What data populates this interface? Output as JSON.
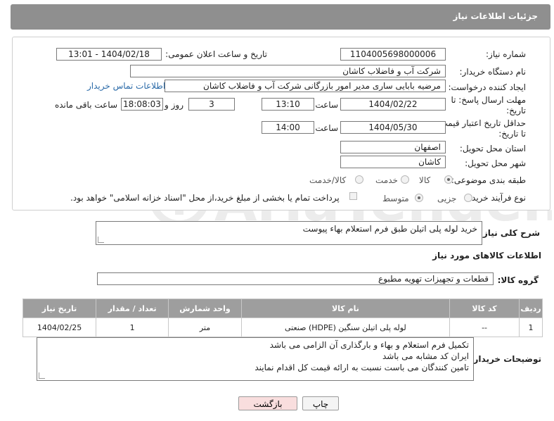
{
  "header": {
    "title": "جزئیات اطلاعات نیاز"
  },
  "need_number": {
    "label": "شماره نیاز:",
    "value": "1104005698000006"
  },
  "announce": {
    "label": "تاریخ و ساعت اعلان عمومی:",
    "value": "1404/02/18 - 13:01"
  },
  "buyer_org": {
    "label": "نام دستگاه خریدار:",
    "value": "شرکت آب و فاضلاب کاشان"
  },
  "creator": {
    "label": "ایجاد کننده درخواست:",
    "value": "مرضیه بابایی ساری مدیر امور بازرگانی شرکت آب و فاضلاب کاشان",
    "contact_link": "اطلاعات تماس خریدار"
  },
  "reply_deadline": {
    "label": "مهلت ارسال پاسخ: تا تاریخ:",
    "date": "1404/02/22",
    "time_label": "ساعت",
    "time": "13:10",
    "days": "3",
    "days_label": "روز و",
    "remaining": "18:08:03",
    "remaining_label": "ساعت باقی مانده"
  },
  "price_validity": {
    "label": "حداقل تاریخ اعتبار قیمت: تا تاریخ:",
    "date": "1404/05/30",
    "time_label": "ساعت",
    "time": "14:00"
  },
  "province": {
    "label": "استان محل تحویل:",
    "value": "اصفهان"
  },
  "city": {
    "label": "شهر محل تحویل:",
    "value": "کاشان"
  },
  "category": {
    "label": "طبقه بندی موضوعی:",
    "options": [
      "کالا",
      "خدمت",
      "کالا/خدمت"
    ],
    "selected": "کالا"
  },
  "purchase_type": {
    "label": "نوع فرآیند خرید :",
    "options": [
      "جزیی",
      "متوسط"
    ],
    "selected": "متوسط",
    "treasury_note": "پرداخت تمام یا بخشی از مبلغ خرید،از محل \"اسناد خزانه اسلامی\" خواهد بود."
  },
  "description": {
    "label": "شرح کلی نیاز:",
    "value": "خرید لوله پلی اتیلن طبق فرم استعلام بهاء پیوست"
  },
  "goods_section": {
    "title": "اطلاعات کالاهای مورد نیاز"
  },
  "goods_group": {
    "label": "گروه کالا:",
    "value": "قطعات و تجهیزات تهویه مطبوع"
  },
  "table": {
    "headers": [
      "ردیف",
      "کد کالا",
      "نام کالا",
      "واحد شمارش",
      "تعداد / مقدار",
      "تاریخ نیاز"
    ],
    "rows": [
      [
        "1",
        "--",
        "لوله پلی اتیلن سنگین (HDPE) صنعتی",
        "متر",
        "1",
        "1404/02/25"
      ]
    ]
  },
  "buyer_notes": {
    "label": "توضیحات خریدار:",
    "lines": [
      "تکمیل فرم استعلام و بهاء و بارگذاری آن الزامی می باشد",
      "ایران کد مشابه می باشد",
      "تامین کنندگان می باست نسبت به ارائه قیمت کل اقدام نمایند"
    ]
  },
  "buttons": {
    "print": "چاپ",
    "back": "بازگشت"
  },
  "colors": {
    "header_bg": "#8f8f8f",
    "table_header_bg": "#9e9e9e",
    "link": "#2a6aa8",
    "back_btn_bg": "#f9dede"
  }
}
